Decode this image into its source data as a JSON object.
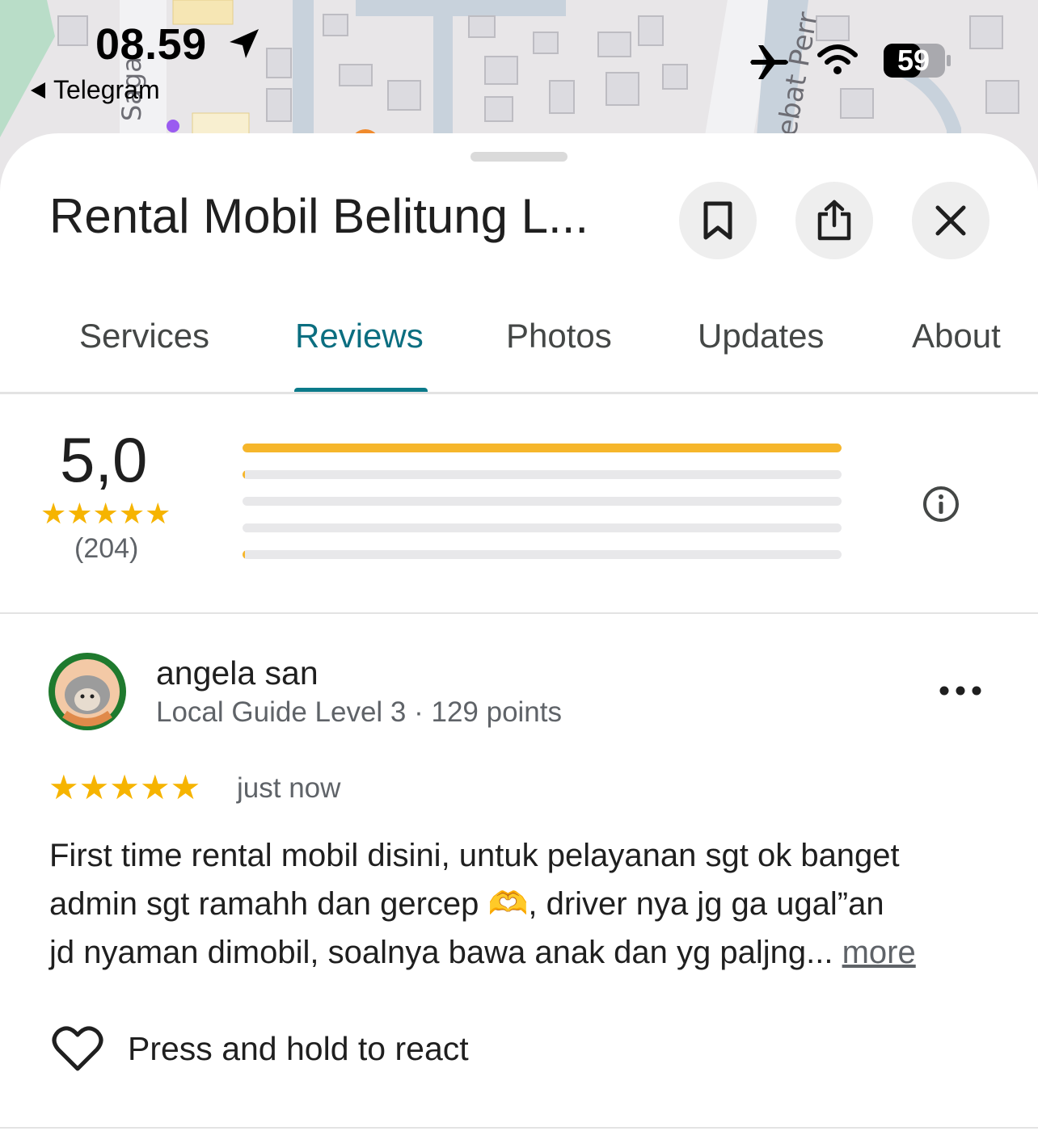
{
  "status_bar": {
    "time": "08.59",
    "back_app": "Telegram",
    "battery_level": "59",
    "icons": [
      "location-arrow-icon",
      "airplane-icon",
      "wifi-icon",
      "battery-icon"
    ]
  },
  "map": {
    "street_labels": [
      "Saga",
      "ebat Perr"
    ]
  },
  "sheet": {
    "title": "Rental Mobil Belitung L...",
    "actions": [
      "bookmark-icon",
      "share-icon",
      "close-icon"
    ]
  },
  "tabs": [
    {
      "label": "Services",
      "active": false
    },
    {
      "label": "Reviews",
      "active": true
    },
    {
      "label": "Photos",
      "active": false
    },
    {
      "label": "Updates",
      "active": false
    },
    {
      "label": "About",
      "active": false
    }
  ],
  "rating_summary": {
    "score": "5,0",
    "stars": "★★★★★",
    "count": "(204)",
    "distribution": [
      {
        "stars": 5,
        "fraction": 1.0
      },
      {
        "stars": 4,
        "fraction": 0.004
      },
      {
        "stars": 3,
        "fraction": 0.0
      },
      {
        "stars": 2,
        "fraction": 0.0
      },
      {
        "stars": 1,
        "fraction": 0.004
      }
    ],
    "bar_color": "#f6b62b"
  },
  "review": {
    "author": "angela san",
    "author_meta": "Local Guide Level 3 · 129 points",
    "stars": "★★★★★",
    "time": "just now",
    "text_lines": [
      "First time rental mobil disini, untuk pelayanan sgt ok banget",
      "admin sgt ramahh dan gercep 🫶, driver nya jg ga ugal”an",
      "jd nyaman dimobil, soalnya bawa anak dan yg paljng... "
    ],
    "more_label": "more",
    "react_label": "Press and hold to react"
  },
  "colors": {
    "accent": "#0b6e80",
    "star": "#f6b400",
    "text": "#1f1f1f",
    "secondary_text": "#5f6368"
  }
}
